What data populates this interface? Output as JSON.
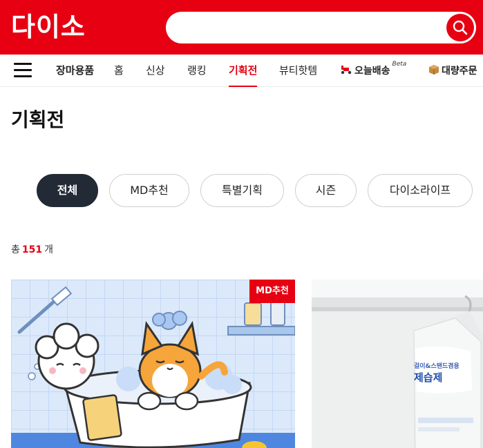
{
  "header": {
    "logo": "다이소",
    "search_placeholder": "",
    "brand_color": "#e60012"
  },
  "nav": {
    "menu_icon": "hamburger-menu-icon",
    "items": [
      {
        "label": "장마용품"
      },
      {
        "label": "홈"
      },
      {
        "label": "신상"
      },
      {
        "label": "랭킹"
      },
      {
        "label": "기획전"
      },
      {
        "label": "뷰티핫템"
      },
      {
        "label": "오늘배송",
        "badge": "Beta",
        "icon": "scooter-icon"
      },
      {
        "label": "대량주문",
        "icon": "box-icon"
      }
    ],
    "active": "기획전"
  },
  "page": {
    "title": "기획전"
  },
  "filters": {
    "items": [
      {
        "label": "전체"
      },
      {
        "label": "MD추천"
      },
      {
        "label": "특별기획"
      },
      {
        "label": "시즌"
      },
      {
        "label": "다이소라이프"
      }
    ],
    "active": "전체"
  },
  "count": {
    "prefix": "총",
    "value": "151",
    "suffix": "개"
  },
  "cards": [
    {
      "badge": "MD추천",
      "image": "cat-and-dog-bath-illustration"
    },
    {
      "product_text_line1": "걸이&스탠드겸용",
      "product_text_line2": "제습제",
      "image": "hanging-dehumidifier-photo"
    }
  ],
  "colors": {
    "accent": "#e60012",
    "active_filter_bg": "#222a35",
    "border": "#cfcfcf"
  }
}
